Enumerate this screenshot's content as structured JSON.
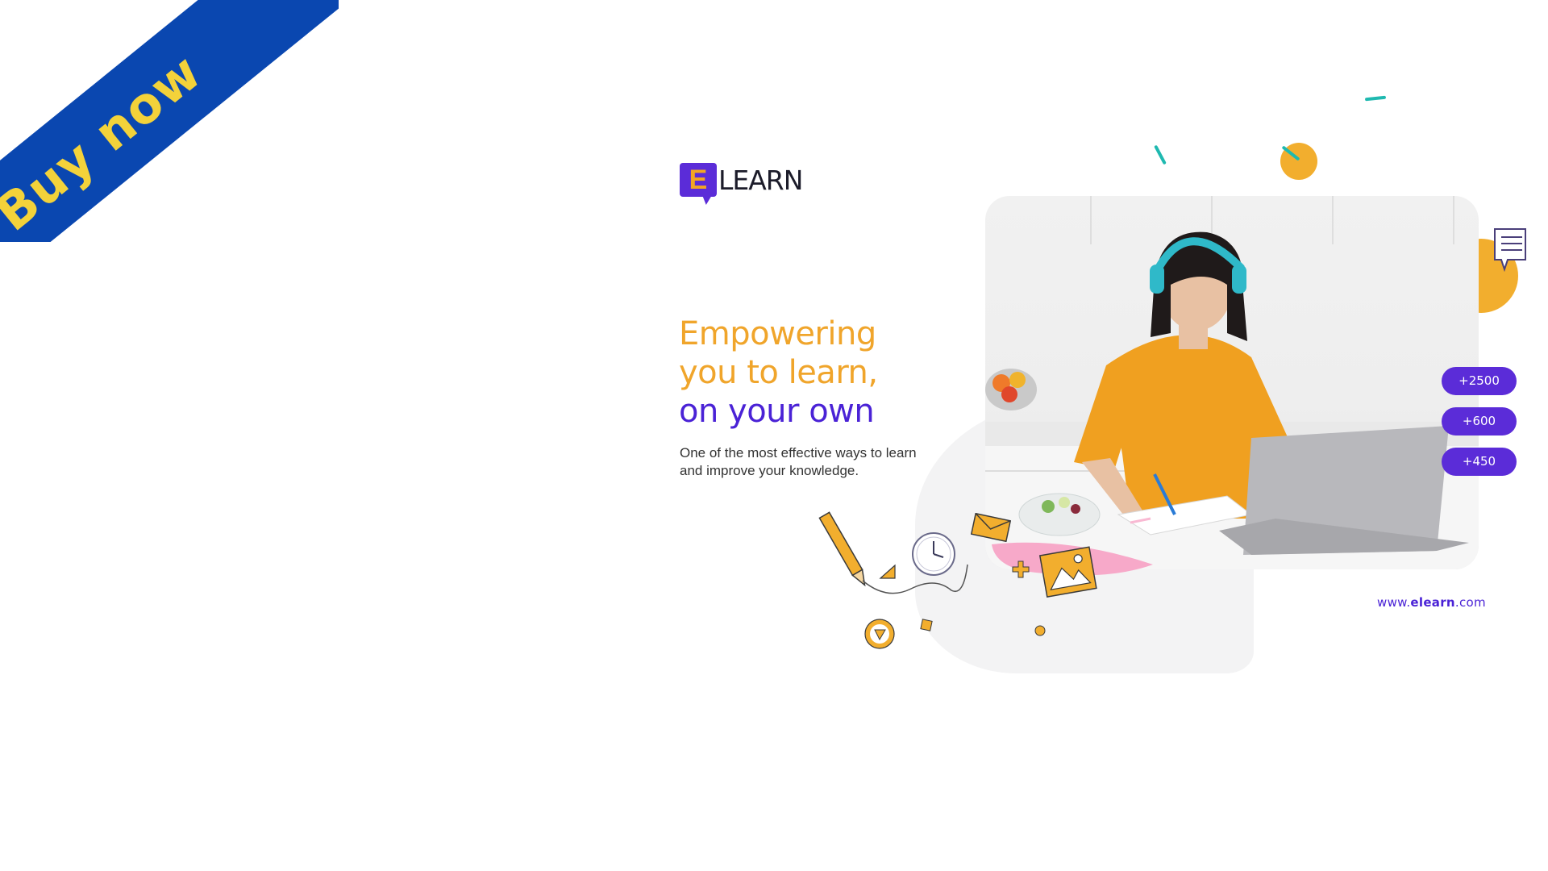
{
  "ribbon": {
    "label": "Buy now",
    "background": "#0a47b0",
    "text_color": "#f3d23a"
  },
  "logo": {
    "mark_letter": "E",
    "text": "LEARN"
  },
  "hero": {
    "headline_line1": "Empowering",
    "headline_line2": "you to learn,",
    "headline_line3": "on your own",
    "subtext": "One of the most effective ways to learn and improve your knowledge."
  },
  "stats": [
    "+2500",
    "+600",
    "+450"
  ],
  "footer": {
    "url_prefix": "www.",
    "url_brand": "elearn",
    "url_suffix": ".com"
  },
  "colors": {
    "orange": "#f0a52b",
    "purple": "#4a22d6",
    "pill": "#5b2cd8",
    "teal": "#1fb9b0"
  }
}
